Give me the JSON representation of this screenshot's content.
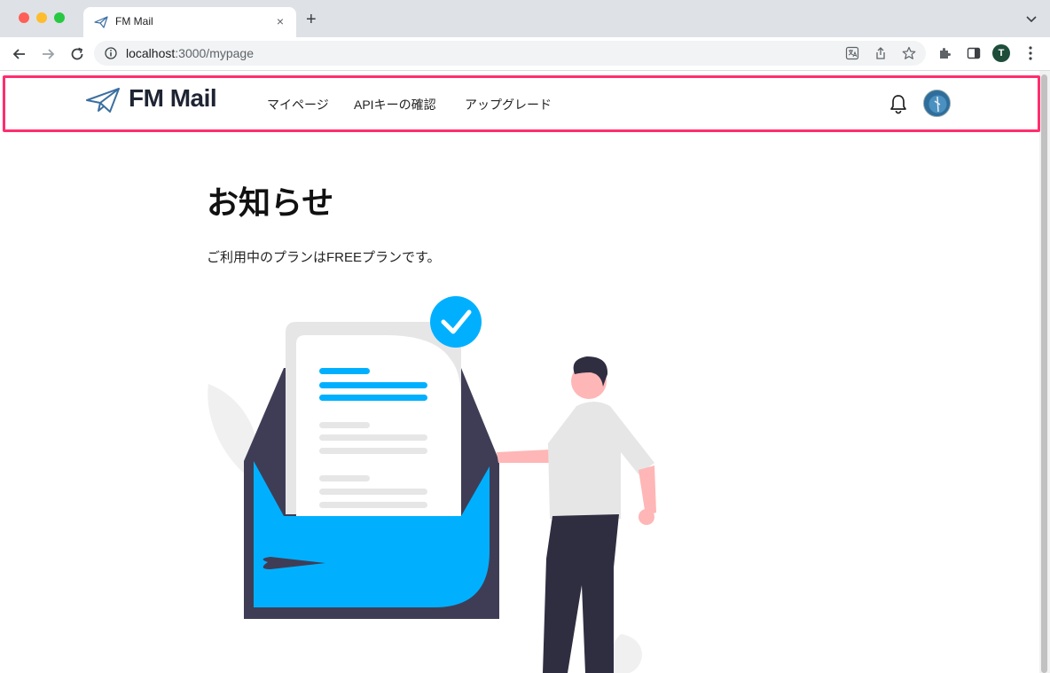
{
  "browser": {
    "tab_title": "FM Mail",
    "tab_close": "×",
    "new_tab": "+",
    "url_host": "localhost",
    "url_path": ":3000/mypage",
    "profile_initial": "T"
  },
  "header": {
    "brand": "FM Mail",
    "nav": [
      "マイページ",
      "APIキーの確認",
      "アップグレード"
    ]
  },
  "main": {
    "title": "お知らせ",
    "plan_text": "ご利用中のプランはFREEプランです。"
  },
  "colors": {
    "accent": "#00b0ff",
    "highlight": "#ff2e6e",
    "brand_text": "#1f2433"
  }
}
